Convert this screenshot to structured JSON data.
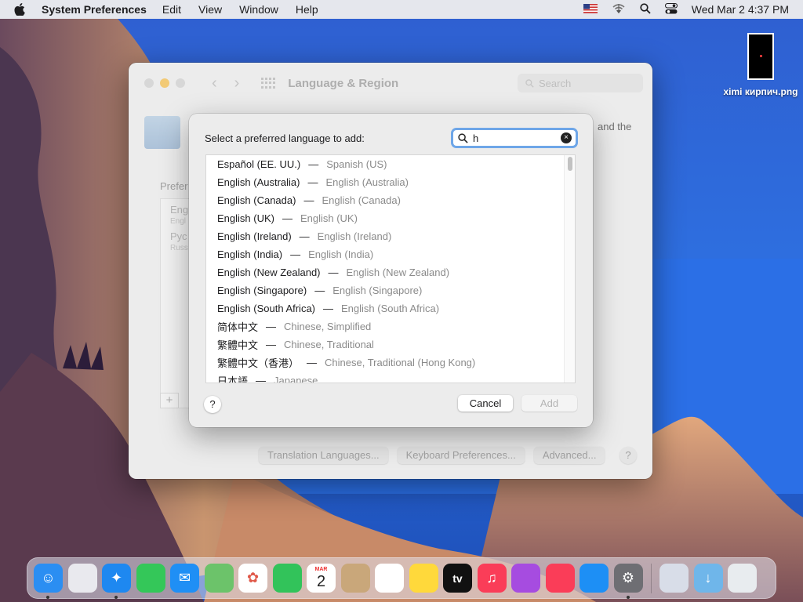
{
  "menubar": {
    "app_name": "System Preferences",
    "items": [
      "Edit",
      "View",
      "Window",
      "Help"
    ],
    "datetime": "Wed Mar 2  4:37 PM"
  },
  "desktop": {
    "file_name": "ximi кирпич.png"
  },
  "window": {
    "title": "Language & Region",
    "search_placeholder": "Search",
    "partial_text": "and the",
    "preferred_label": "Prefer",
    "pref_items": [
      {
        "name": "Eng",
        "sub": "Engl"
      },
      {
        "name": "Рус",
        "sub": "Russ"
      }
    ],
    "plus_label": "+",
    "buttons": [
      "Translation Languages...",
      "Keyboard Preferences...",
      "Advanced..."
    ],
    "help_label": "?"
  },
  "sheet": {
    "prompt": "Select a preferred language to add:",
    "search_value": "h",
    "clear_label": "×",
    "dash": "—",
    "languages": [
      {
        "native": "Español (EE. UU.)",
        "english": "Spanish (US)"
      },
      {
        "native": "English (Australia)",
        "english": "English (Australia)"
      },
      {
        "native": "English (Canada)",
        "english": "English (Canada)"
      },
      {
        "native": "English (UK)",
        "english": "English (UK)"
      },
      {
        "native": "English (Ireland)",
        "english": "English (Ireland)"
      },
      {
        "native": "English (India)",
        "english": "English (India)"
      },
      {
        "native": "English (New Zealand)",
        "english": "English (New Zealand)"
      },
      {
        "native": "English (Singapore)",
        "english": "English (Singapore)"
      },
      {
        "native": "English (South Africa)",
        "english": "English (South Africa)"
      },
      {
        "native": "简体中文",
        "english": "Chinese, Simplified"
      },
      {
        "native": "繁體中文",
        "english": "Chinese, Traditional"
      },
      {
        "native": "繁體中文（香港）",
        "english": "Chinese, Traditional (Hong Kong)"
      },
      {
        "native": "日本語",
        "english": "Japanese"
      }
    ],
    "help_label": "?",
    "cancel_label": "Cancel",
    "add_label": "Add"
  },
  "dock": {
    "apps": [
      {
        "name": "finder-icon",
        "color": "#2b8ef2",
        "glyph": "☺",
        "running": true
      },
      {
        "name": "launchpad-icon",
        "color": "#e9e9ee",
        "glyph": "",
        "running": false
      },
      {
        "name": "safari-icon",
        "color": "#1e88f0",
        "glyph": "✦",
        "running": true
      },
      {
        "name": "messages-icon",
        "color": "#34c759",
        "glyph": "",
        "running": false
      },
      {
        "name": "mail-icon",
        "color": "#1f8ff5",
        "glyph": "✉",
        "running": false
      },
      {
        "name": "maps-icon",
        "color": "#6cc36a",
        "glyph": "",
        "running": false
      },
      {
        "name": "photos-icon",
        "color": "#ffffff",
        "glyph": "✿",
        "running": false
      },
      {
        "name": "facetime-icon",
        "color": "#32c35a",
        "glyph": "",
        "running": false
      },
      {
        "name": "calendar-icon",
        "color": "#ffffff",
        "glyph": "",
        "running": false
      },
      {
        "name": "contacts-icon",
        "color": "#c9a77a",
        "glyph": "",
        "running": false
      },
      {
        "name": "reminders-icon",
        "color": "#ffffff",
        "glyph": "",
        "running": false
      },
      {
        "name": "notes-icon",
        "color": "#ffd93b",
        "glyph": "",
        "running": false
      },
      {
        "name": "tv-icon",
        "color": "#111111",
        "glyph": "",
        "running": false
      },
      {
        "name": "music-icon",
        "color": "#fa3d58",
        "glyph": "♫",
        "running": false
      },
      {
        "name": "podcasts-icon",
        "color": "#a64ce0",
        "glyph": "",
        "running": false
      },
      {
        "name": "news-icon",
        "color": "#fa3d58",
        "glyph": "",
        "running": false
      },
      {
        "name": "app-store-icon",
        "color": "#1d8ff5",
        "glyph": "",
        "running": false
      },
      {
        "name": "system-preferences-icon",
        "color": "#6e6e73",
        "glyph": "⚙",
        "running": true
      }
    ],
    "calendar_month": "MAR",
    "calendar_day": "2",
    "tv_label": "tv"
  },
  "colors": {
    "accent": "#6ea6e8",
    "min_button": "#f5bf4f"
  }
}
